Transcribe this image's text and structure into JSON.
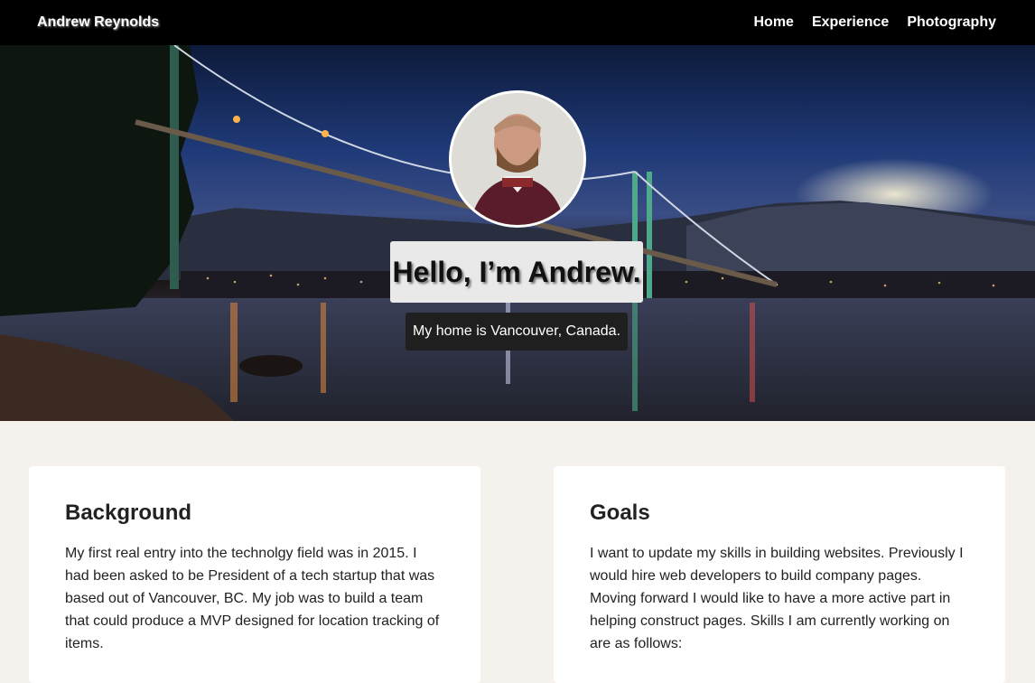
{
  "nav": {
    "brand": "Andrew Reynolds",
    "links": [
      {
        "label": "Home"
      },
      {
        "label": "Experience"
      },
      {
        "label": "Photography"
      }
    ]
  },
  "hero": {
    "title": "Hello, I’m Andrew.",
    "subtitle": "My home is Vancouver, Canada."
  },
  "cards": [
    {
      "heading": "Background",
      "body": "My first real entry into the technolgy field was in 2015. I had been asked to be President of a tech startup that was based out of Vancouver, BC. My job was to build a team that could produce a MVP designed for location tracking of items."
    },
    {
      "heading": "Goals",
      "body": "I want to update my skills in building websites. Previously I would hire web developers to build company pages. Moving forward I would like to have a more active part in helping construct pages. Skills I am currently working on are as follows:"
    }
  ],
  "colors": {
    "nav_bg": "#000000",
    "page_bg": "#f5f2ed",
    "card_bg": "#ffffff",
    "subtitle_bg": "#1f1f1f"
  }
}
